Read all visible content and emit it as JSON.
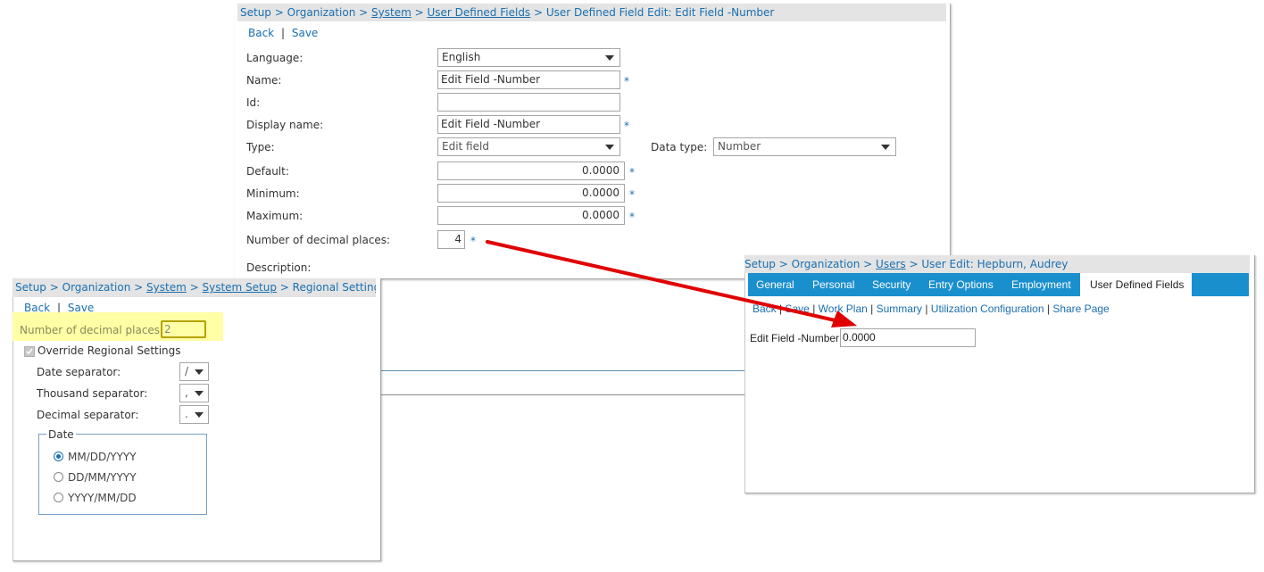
{
  "field_edit": {
    "breadcrumb": [
      {
        "text": "Setup",
        "sep": " > ",
        "underline": false
      },
      {
        "text": "Organization",
        "sep": " > ",
        "underline": false
      },
      {
        "text": "System",
        "sep": " > ",
        "underline": true
      },
      {
        "text": "User Defined Fields",
        "sep": " > ",
        "underline": true
      },
      {
        "text": "User Defined Field Edit: Edit Field -Number",
        "sep": "",
        "underline": false
      }
    ],
    "back_label": "Back",
    "save_label": "Save",
    "link_sep": "|",
    "language_label": "Language:",
    "language_value": "English",
    "name_label": "Name:",
    "name_value": "Edit Field -Number",
    "id_label": "Id:",
    "id_value": "",
    "display_name_label": "Display name:",
    "display_name_value": "Edit Field -Number",
    "type_label": "Type:",
    "type_value": "Edit field",
    "data_type_label": "Data type:",
    "data_type_value": "Number",
    "default_label": "Default:",
    "default_value": "0.0000",
    "minimum_label": "Minimum:",
    "minimum_value": "0.0000",
    "maximum_label": "Maximum:",
    "maximum_value": "0.0000",
    "decimals_label": "Number of decimal places:",
    "decimals_value": "4",
    "description_label": "Description:",
    "required_mark": "*"
  },
  "regional": {
    "breadcrumb": [
      {
        "text": "Setup",
        "sep": " > ",
        "underline": false
      },
      {
        "text": "Organization",
        "sep": " > ",
        "underline": false
      },
      {
        "text": "System",
        "sep": " > ",
        "underline": true
      },
      {
        "text": "System Setup",
        "sep": " > ",
        "underline": true
      },
      {
        "text": "Regional Settings",
        "sep": "",
        "underline": false
      }
    ],
    "back_label": "Back",
    "save_label": "Save",
    "link_sep": "|",
    "decimals_label": "Number of decimal places:",
    "decimals_value": "2",
    "override_label": "Override Regional Settings",
    "override_checked": true,
    "date_sep_label": "Date separator:",
    "date_sep_value": "/",
    "thousand_sep_label": "Thousand separator:",
    "thousand_sep_value": ",",
    "decimal_sep_label": "Decimal separator:",
    "decimal_sep_value": ".",
    "date_group_label": "Date",
    "date_formats": [
      "MM/DD/YYYY",
      "DD/MM/YYYY",
      "YYYY/MM/DD"
    ],
    "date_format_selected": "MM/DD/YYYY",
    "highlight_color": "#ffffa6"
  },
  "user_edit": {
    "breadcrumb": [
      {
        "text": "Setup",
        "sep": " > ",
        "underline": false
      },
      {
        "text": "Organization",
        "sep": " > ",
        "underline": false
      },
      {
        "text": "Users",
        "sep": " > ",
        "underline": true
      },
      {
        "text": "User Edit: Hepburn, Audrey",
        "sep": "",
        "underline": false
      }
    ],
    "tabs": [
      "General",
      "Personal",
      "Security",
      "Entry Options",
      "Employment",
      "User Defined Fields"
    ],
    "active_tab": "User Defined Fields",
    "links": [
      "Back",
      "Save",
      "Work Plan",
      "Summary",
      "Utilization Configuration",
      "Share Page"
    ],
    "link_sep": "|",
    "field_label": "Edit Field -Number",
    "field_value": "0.0000",
    "tab_bar_color": "#1a8fce"
  },
  "annotation": {
    "arrow_color": "#e00000"
  },
  "colors": {
    "link": "#1a6fb0",
    "breadcrumb_bg": "#e4e4e4",
    "tab_bar": "#1a8fce"
  }
}
